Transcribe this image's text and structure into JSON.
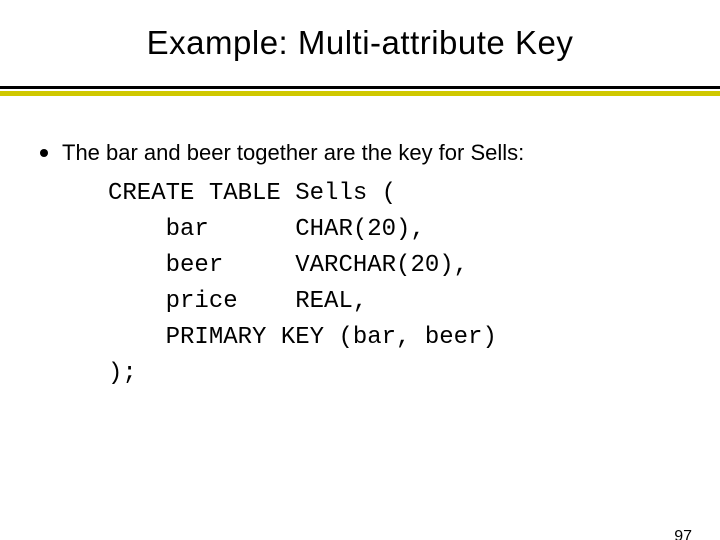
{
  "slide": {
    "title": "Example: Multi-attribute Key",
    "bullet": "The bar and beer together are the key for Sells:",
    "code": "CREATE TABLE Sells (\n    bar      CHAR(20),\n    beer     VARCHAR(20),\n    price    REAL,\n    PRIMARY KEY (bar, beer)\n);",
    "page_number": "97"
  }
}
